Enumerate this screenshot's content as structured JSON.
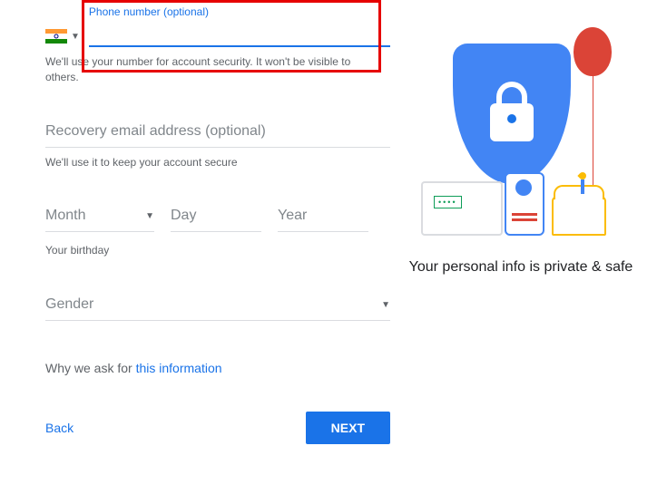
{
  "phone": {
    "label": "Phone number (optional)",
    "value": "",
    "helper": "We'll use your number for account security. It won't be visible to others.",
    "country": "India"
  },
  "recovery": {
    "placeholder": "Recovery email address (optional)",
    "helper": "We'll use it to keep your account secure"
  },
  "birthday": {
    "month_placeholder": "Month",
    "day_placeholder": "Day",
    "year_placeholder": "Year",
    "label": "Your birthday"
  },
  "gender": {
    "placeholder": "Gender"
  },
  "info": {
    "prefix": "Why we ask for ",
    "link": "this information"
  },
  "actions": {
    "back": "Back",
    "next": "NEXT"
  },
  "illustration": {
    "tagline": "Your personal info is private & safe"
  }
}
